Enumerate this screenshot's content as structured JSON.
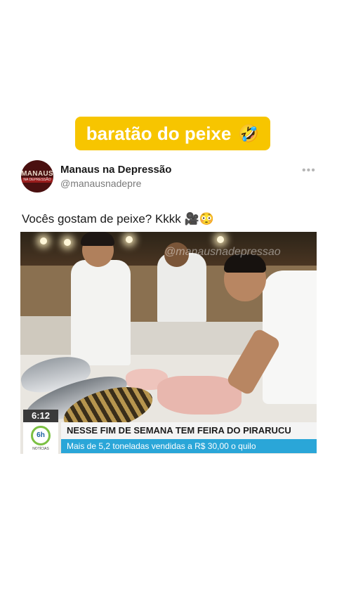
{
  "banner": {
    "text": "baratão do peixe",
    "emoji": "🤣"
  },
  "account": {
    "avatar_line1": "MANAUS",
    "avatar_line2": "NA DEPRESSÃO",
    "name": "Manaus na Depressão",
    "handle": "@manausnadepre"
  },
  "more_menu": "•••",
  "tweet": {
    "text": "Vocês gostam de peixe? Kkkk 🎥😳"
  },
  "video": {
    "watermark": "@manausnadepressao",
    "time": "6:12",
    "channel_logo": "6h",
    "channel_sub": "NOTÍCIAS",
    "headline": "NESSE FIM DE SEMANA TEM FEIRA DO PIRARUCU",
    "subline": "Mais de 5,2 toneladas vendidas a R$ 30,00 o quilo"
  },
  "colors": {
    "banner": "#f7c500",
    "news_bar": "#2aa6d8",
    "avatar": "#4a1010"
  }
}
